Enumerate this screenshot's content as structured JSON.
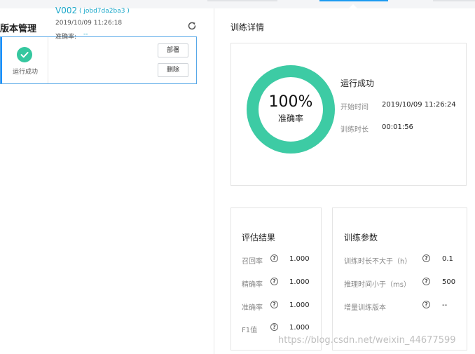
{
  "version_panel": {
    "title": "版本管理",
    "versions": [
      {
        "status": "运行成功",
        "name": "V002",
        "job_id": "( jobd7da2ba3 )",
        "date": "2019/10/09 11:26:18",
        "accuracy_label": "准确率:",
        "accuracy_value": "--",
        "deploy_label": "部署",
        "delete_label": "删除"
      }
    ]
  },
  "detail": {
    "title": "训练详情",
    "progress": {
      "percent_text": "100%",
      "label": "准确率",
      "fraction": 1.0,
      "color": "#3dcba4"
    },
    "run_status": "运行成功",
    "start_time_label": "开始时间",
    "start_time_value": "2019/10/09 11:26:24",
    "duration_label": "训练时长",
    "duration_value": "00:01:56"
  },
  "evaluation": {
    "title": "评估结果",
    "rows": [
      {
        "label": "召回率",
        "value": "1.000"
      },
      {
        "label": "精确率",
        "value": "1.000"
      },
      {
        "label": "准确率",
        "value": "1.000"
      },
      {
        "label": "F1值",
        "value": "1.000"
      }
    ]
  },
  "params": {
    "title": "训练参数",
    "rows": [
      {
        "label": "训练时长不大于（h）",
        "value": "0.1"
      },
      {
        "label": "推理时间小于（ms）",
        "value": "500"
      },
      {
        "label": "增量训练版本",
        "value": "--"
      }
    ]
  },
  "help_glyph": "?",
  "watermark": "https://blog.csdn.net/weixin_44677599",
  "colors": {
    "accent": "#1aa7c9",
    "success": "#35c79f",
    "selected_border": "#58a8e8"
  },
  "icons": {
    "refresh": "refresh-icon",
    "check": "check-circle-icon",
    "help": "help-icon"
  }
}
